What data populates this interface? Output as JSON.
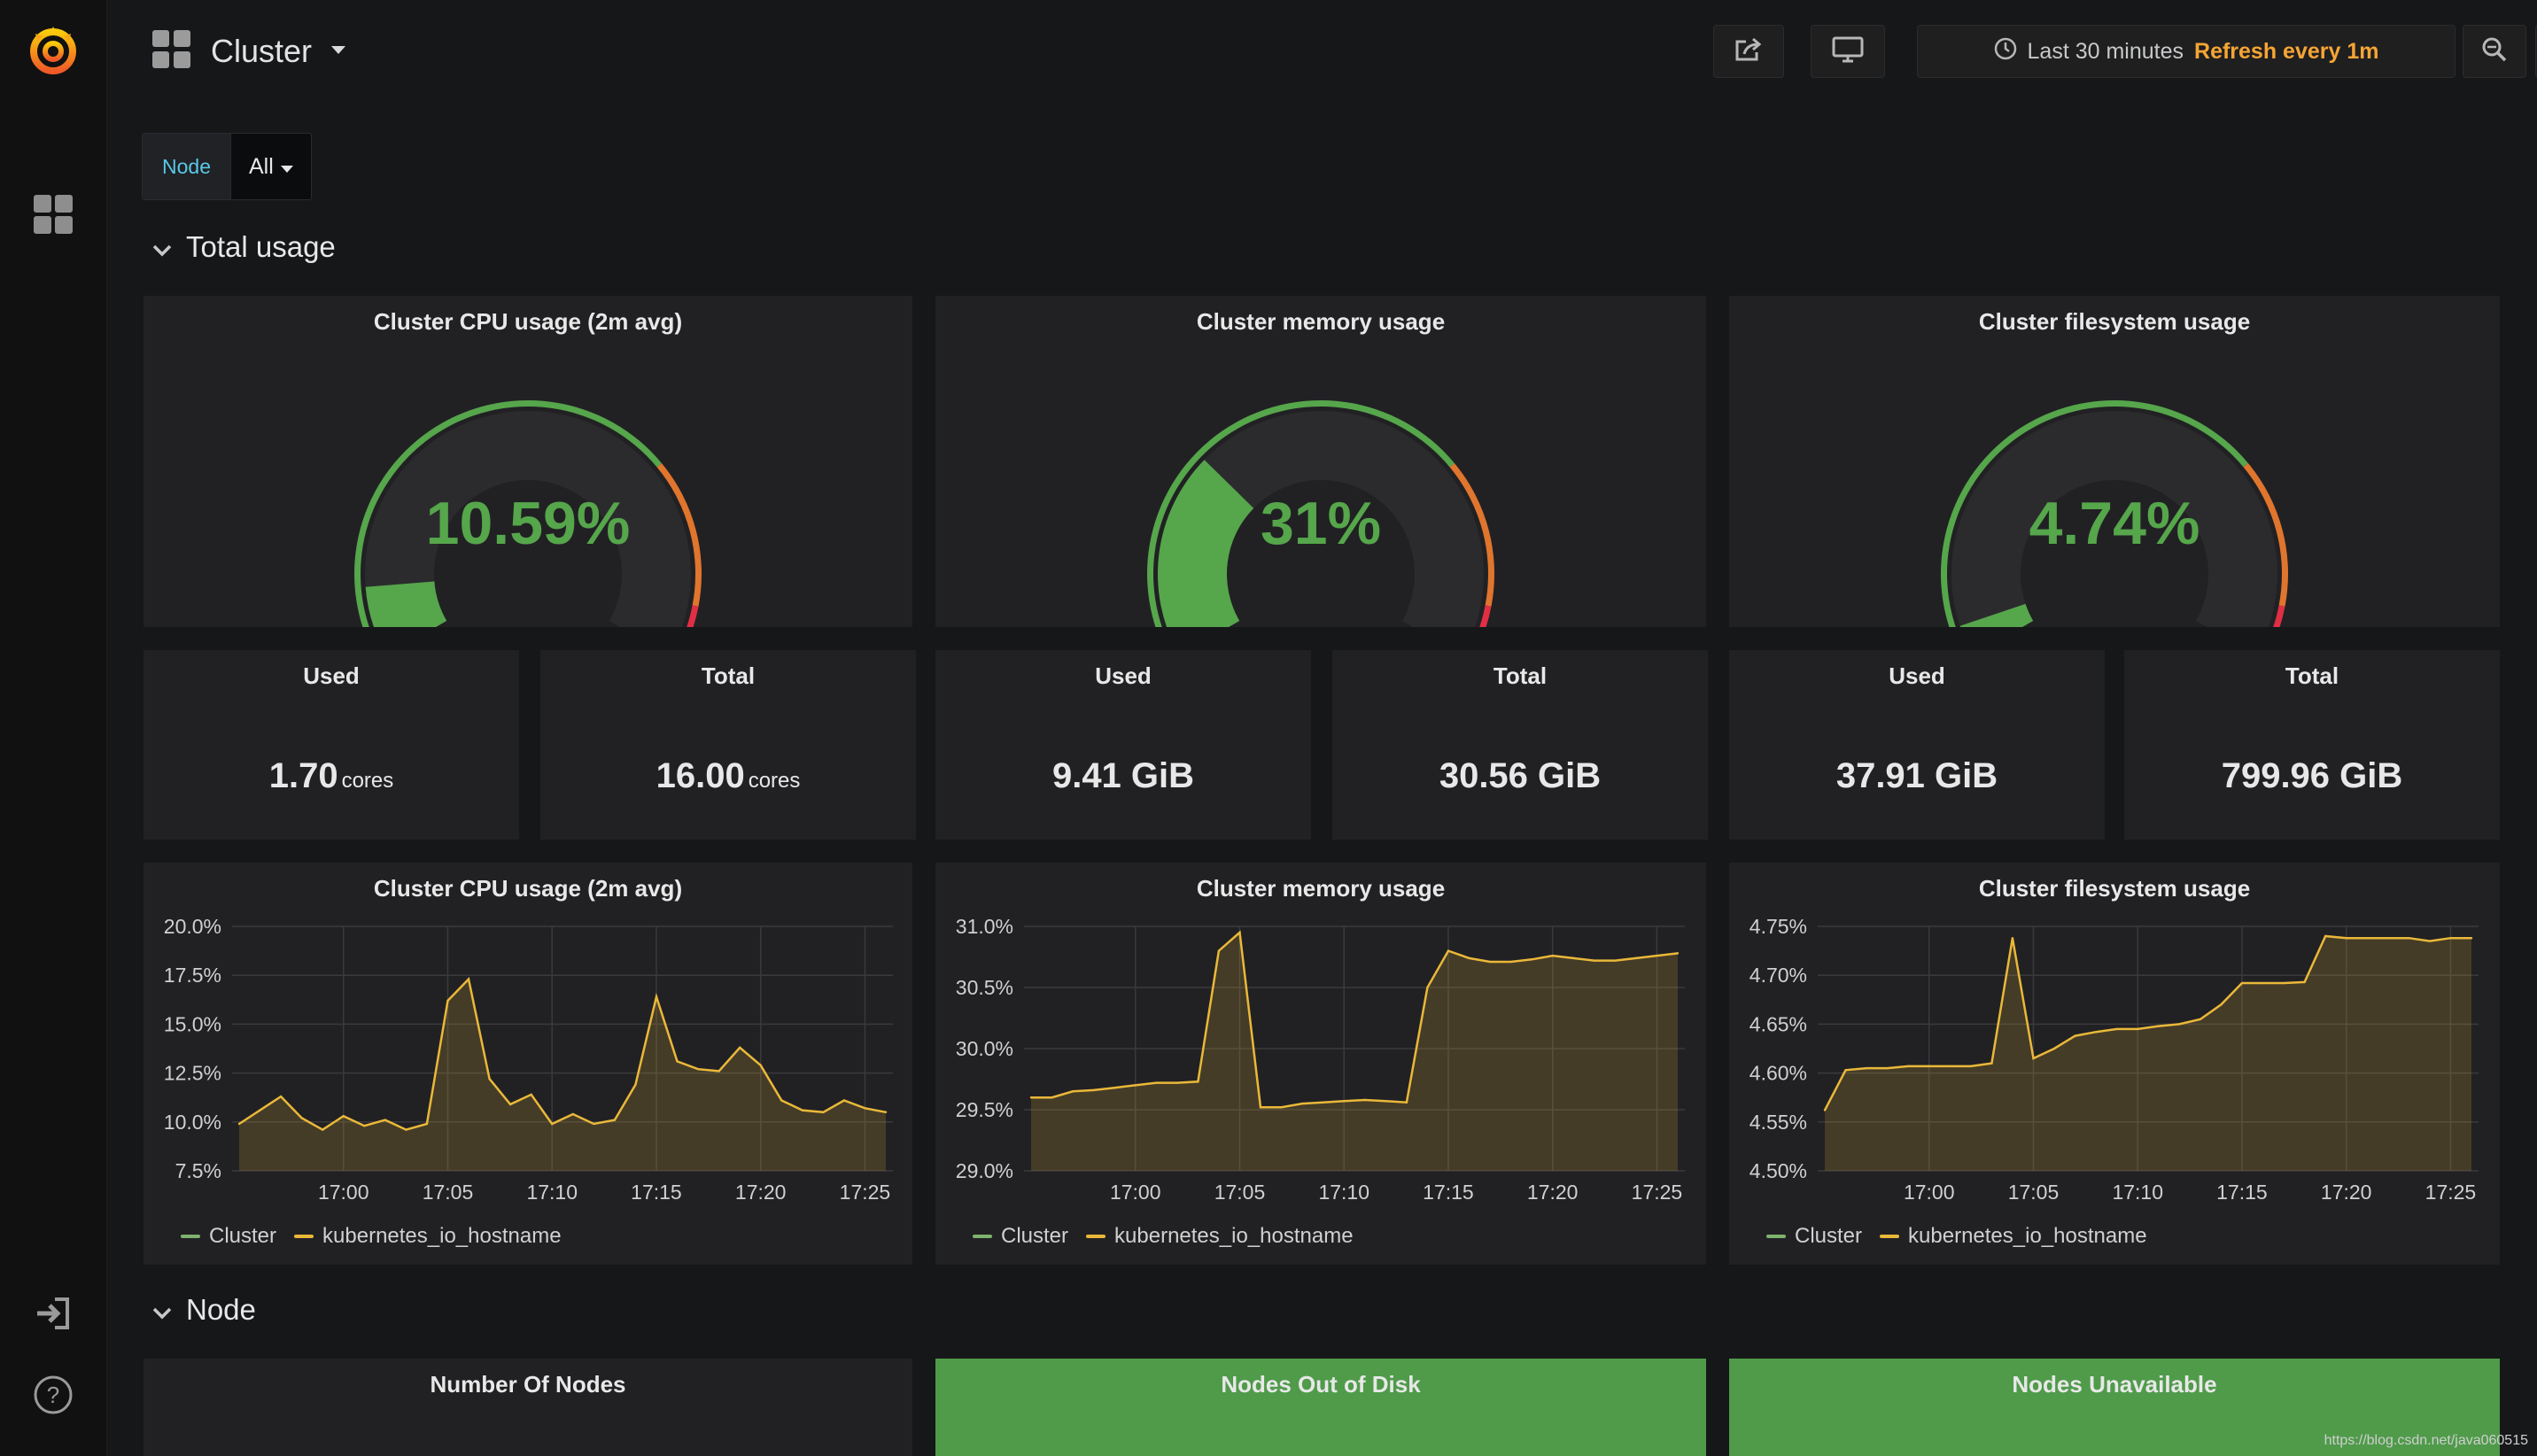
{
  "header": {
    "title": "Cluster",
    "time_range": "Last 30 minutes",
    "refresh": "Refresh every 1m"
  },
  "variables": [
    {
      "label": "Node",
      "value": "All"
    }
  ],
  "rows": {
    "total_usage": "Total usage",
    "node": "Node"
  },
  "gauges": [
    {
      "title": "Cluster CPU usage (2m avg)",
      "value": "10.59%",
      "fraction": 0.1059
    },
    {
      "title": "Cluster memory usage",
      "value": "31%",
      "fraction": 0.31
    },
    {
      "title": "Cluster filesystem usage",
      "value": "4.74%",
      "fraction": 0.0474
    }
  ],
  "stats": [
    {
      "title": "Used",
      "value": "1.70",
      "unit": "cores"
    },
    {
      "title": "Total",
      "value": "16.00",
      "unit": "cores"
    },
    {
      "title": "Used",
      "value": "9.41 GiB",
      "unit": ""
    },
    {
      "title": "Total",
      "value": "30.56 GiB",
      "unit": ""
    },
    {
      "title": "Used",
      "value": "37.91 GiB",
      "unit": ""
    },
    {
      "title": "Total",
      "value": "799.96 GiB",
      "unit": ""
    }
  ],
  "graphs": [
    {
      "title": "Cluster CPU usage (2m avg)",
      "y_ticks": [
        "20.0%",
        "17.5%",
        "15.0%",
        "12.5%",
        "10.0%",
        "7.5%"
      ]
    },
    {
      "title": "Cluster memory usage",
      "y_ticks": [
        "31.0%",
        "30.5%",
        "30.0%",
        "29.5%",
        "29.0%"
      ]
    },
    {
      "title": "Cluster filesystem usage",
      "y_ticks": [
        "4.75%",
        "4.70%",
        "4.65%",
        "4.60%",
        "4.55%",
        "4.50%"
      ]
    }
  ],
  "x_ticks": [
    "17:00",
    "17:05",
    "17:10",
    "17:15",
    "17:20",
    "17:25"
  ],
  "legend": [
    "Cluster",
    "kubernetes_io_hostname"
  ],
  "colors": {
    "background": "#161719",
    "panel": "#212124",
    "ok": "#56a64b",
    "warn": "#e0752d",
    "critical": "#e02f44",
    "series_cluster": "#7eb26d",
    "series_host": "#eab839",
    "refresh": "#f6a534",
    "variable_label": "#5ac8e6"
  },
  "chart_data": [
    {
      "type": "line",
      "title": "Cluster CPU usage (2m avg)",
      "x": [
        "16:55",
        "16:56",
        "16:57",
        "16:58",
        "16:59",
        "17:00",
        "17:01",
        "17:02",
        "17:03",
        "17:04",
        "17:05",
        "17:06",
        "17:07",
        "17:08",
        "17:09",
        "17:10",
        "17:11",
        "17:12",
        "17:13",
        "17:14",
        "17:15",
        "17:16",
        "17:17",
        "17:18",
        "17:19",
        "17:20",
        "17:21",
        "17:22",
        "17:23",
        "17:24",
        "17:25",
        "17:26"
      ],
      "ylim": [
        7.5,
        20.0
      ],
      "series": [
        {
          "name": "kubernetes_io_hostname",
          "values": [
            9.9,
            10.6,
            11.3,
            10.2,
            9.6,
            10.3,
            9.8,
            10.1,
            9.6,
            9.9,
            16.2,
            17.3,
            12.2,
            10.9,
            11.4,
            9.9,
            10.4,
            9.9,
            10.1,
            11.9,
            16.4,
            13.1,
            12.7,
            12.6,
            13.8,
            12.9,
            11.1,
            10.6,
            10.5,
            11.1,
            10.7,
            10.5
          ]
        }
      ]
    },
    {
      "type": "line",
      "title": "Cluster memory usage",
      "x": [
        "16:55",
        "16:56",
        "16:57",
        "16:58",
        "16:59",
        "17:00",
        "17:01",
        "17:02",
        "17:03",
        "17:04",
        "17:05",
        "17:06",
        "17:07",
        "17:08",
        "17:09",
        "17:10",
        "17:11",
        "17:12",
        "17:13",
        "17:14",
        "17:15",
        "17:16",
        "17:17",
        "17:18",
        "17:19",
        "17:20",
        "17:21",
        "17:22",
        "17:23",
        "17:24",
        "17:25",
        "17:26"
      ],
      "ylim": [
        29.0,
        31.0
      ],
      "series": [
        {
          "name": "kubernetes_io_hostname",
          "values": [
            29.6,
            29.6,
            29.65,
            29.66,
            29.68,
            29.7,
            29.72,
            29.72,
            29.73,
            30.8,
            30.95,
            29.52,
            29.52,
            29.55,
            29.56,
            29.57,
            29.58,
            29.57,
            29.56,
            30.5,
            30.8,
            30.74,
            30.71,
            30.71,
            30.73,
            30.76,
            30.74,
            30.72,
            30.72,
            30.74,
            30.76,
            30.78
          ]
        }
      ]
    },
    {
      "type": "line",
      "title": "Cluster filesystem usage",
      "x": [
        "16:55",
        "16:56",
        "16:57",
        "16:58",
        "16:59",
        "17:00",
        "17:01",
        "17:02",
        "17:03",
        "17:04",
        "17:05",
        "17:06",
        "17:07",
        "17:08",
        "17:09",
        "17:10",
        "17:11",
        "17:12",
        "17:13",
        "17:14",
        "17:15",
        "17:16",
        "17:17",
        "17:18",
        "17:19",
        "17:20",
        "17:21",
        "17:22",
        "17:23",
        "17:24",
        "17:25",
        "17:26"
      ],
      "ylim": [
        4.5,
        4.75
      ],
      "series": [
        {
          "name": "kubernetes_io_hostname",
          "values": [
            4.562,
            4.603,
            4.605,
            4.605,
            4.607,
            4.607,
            4.607,
            4.607,
            4.61,
            4.738,
            4.615,
            4.625,
            4.638,
            4.642,
            4.645,
            4.645,
            4.648,
            4.65,
            4.655,
            4.67,
            4.692,
            4.692,
            4.692,
            4.693,
            4.74,
            4.738,
            4.738,
            4.738,
            4.738,
            4.735,
            4.738,
            4.738
          ]
        }
      ]
    }
  ]
}
